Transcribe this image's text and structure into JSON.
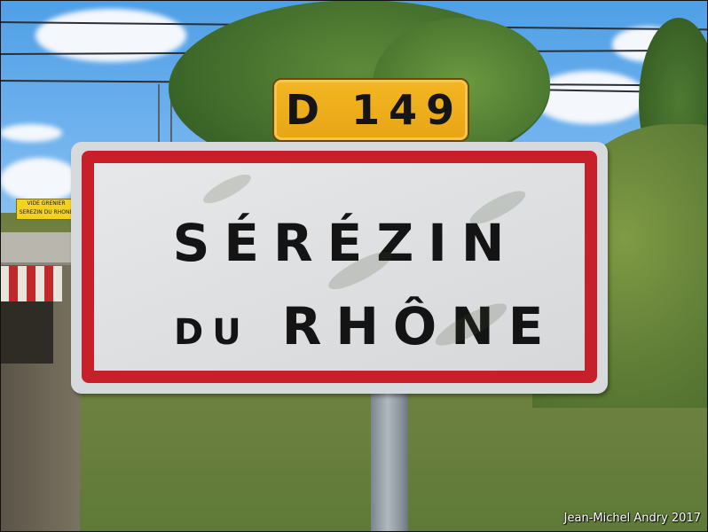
{
  "route_sign": {
    "text": "D 149",
    "color": "#eeac1c"
  },
  "town_sign": {
    "line1": "SÉRÉZIN",
    "line2_small": "DU",
    "line2_big": "RHÔNE",
    "border_color": "#c8202a"
  },
  "background_banner": {
    "line1": "VIDE GRENIER",
    "line2": "SEREZIN DU RHONE"
  },
  "credit": "Jean-Michel Andry 2017"
}
